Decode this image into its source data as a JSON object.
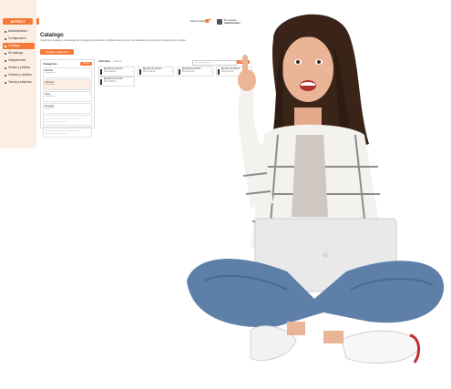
{
  "sidebar": {
    "brand": "APPSOT",
    "items": [
      {
        "label": "Administracion",
        "active": false
      },
      {
        "label": "Configuracion",
        "active": false
      },
      {
        "label": "Catalogo",
        "active": true
      },
      {
        "label": "Mi catalogo",
        "active": false
      },
      {
        "label": "Integraciones",
        "active": false
      },
      {
        "label": "Ventas y pedidos",
        "active": false
      },
      {
        "label": "Clientes y clientes",
        "active": false
      },
      {
        "label": "Tienda y empresa",
        "active": false
      }
    ]
  },
  "topbar": {
    "mode_label": "Modo Palab",
    "user_line1": "Mi empresa",
    "user_line2": "Administrador"
  },
  "page": {
    "title": "Catalogo",
    "description": "Organiza tu catálogo, crea categorías y agrega tus productos. Configura cada uno con sus variantes y precios para mostrarlos en tu tienda.",
    "primary_button": "Agregar categorías"
  },
  "categories": {
    "header": "Categorías",
    "add_label": "Nuevo",
    "items": [
      {
        "name": "Bebidas",
        "sub": "4 productos",
        "active": false
      },
      {
        "name": "Artículos",
        "sub": "3 productos",
        "active": true
      },
      {
        "name": "Otros",
        "sub": "2 productos",
        "active": false
      },
      {
        "name": "Entradas",
        "sub": "1 producto",
        "active": false
      }
    ]
  },
  "products": {
    "header": "Artículos",
    "count": "4 items",
    "search_placeholder": "Buscar productos",
    "add_label": "+ Agregar",
    "cards": [
      {
        "name": "Ejemplo de artículo",
        "sub": "Precio $0.00"
      },
      {
        "name": "Ejemplo de artículo",
        "sub": "Precio $0.00"
      },
      {
        "name": "Ejemplo de artículo",
        "sub": "Precio $0.00"
      },
      {
        "name": "Ejemplo de artículo",
        "sub": "Precio $0.00"
      },
      {
        "name": "Ejemplo de artículo",
        "sub": "Precio $0.00"
      }
    ]
  },
  "colors": {
    "accent": "#f47a3a",
    "sidebar_bg": "#fdeee4"
  }
}
